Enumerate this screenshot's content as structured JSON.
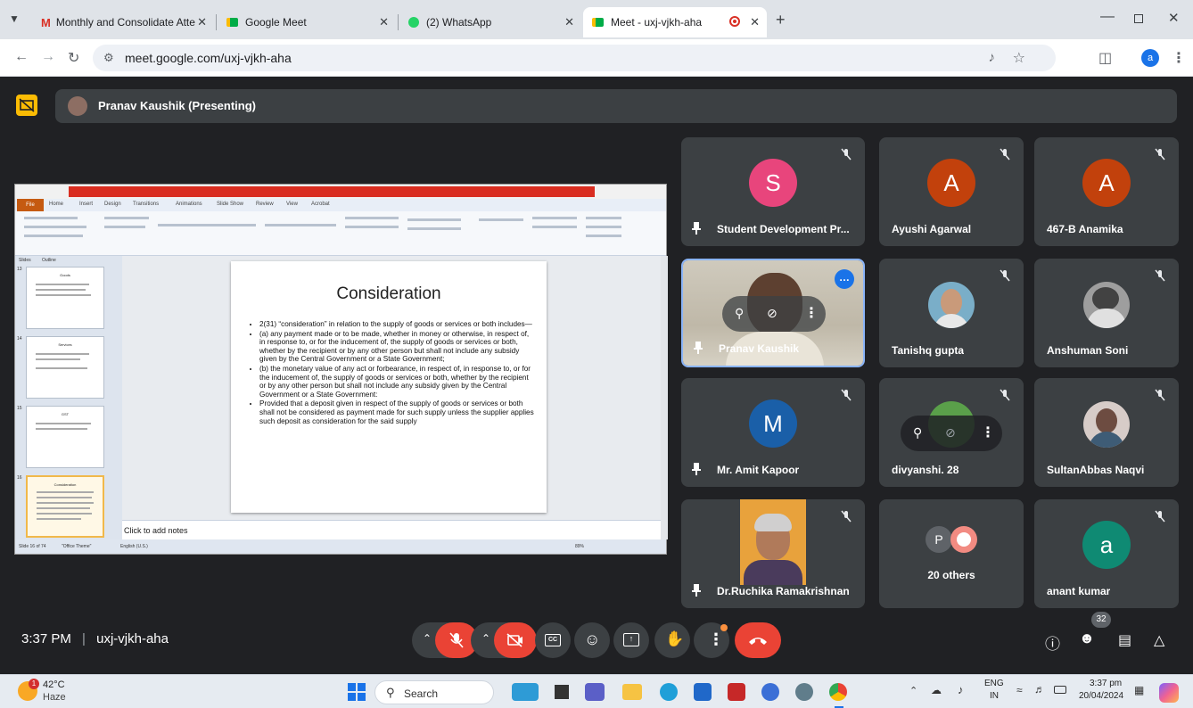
{
  "browser": {
    "tabs": [
      {
        "title": "Monthly and Consolidate Atte",
        "icon": "gmail-icon"
      },
      {
        "title": "Google Meet",
        "icon": "meet-icon"
      },
      {
        "title": "(2) WhatsApp",
        "icon": "whatsapp-icon"
      },
      {
        "title": "Meet - uxj-vjkh-aha",
        "icon": "meet-icon",
        "active": true
      }
    ],
    "url": "meet.google.com/uxj-vjkh-aha"
  },
  "meet": {
    "presenter_banner": "Pranav Kaushik (Presenting)",
    "share": {
      "slide_title": "Consideration",
      "bullets": [
        "2(31) “consideration” in relation to the supply of goods or services or both includes—",
        "(a) any payment made or to be made, whether in money or otherwise, in respect of, in response to, or for the inducement of, the supply of goods or services or both, whether by the recipient or by any other person but shall not include any subsidy given by the Central Government or a State Government;",
        "(b) the monetary value of any act or forbearance, in respect of, in response to, or for the inducement of, the supply of goods or services or both, whether by the recipient or by any other person but shall not include any subsidy given by the Central Government or a State Government:",
        "Provided that a deposit given in respect of the supply of goods or services or both shall not be considered as payment made for such supply unless the supplier applies such deposit as consideration for the said supply"
      ],
      "notes_placeholder": "Click to add notes",
      "thumb_titles": [
        "Goods",
        "Services",
        "GST",
        "Consideration"
      ],
      "thumb_numbers": [
        "13",
        "14",
        "15",
        "16"
      ],
      "ribbon_tabs": [
        "Home",
        "Insert",
        "Design",
        "Transitions",
        "Animations",
        "Slide Show",
        "Review",
        "View",
        "Acrobat"
      ],
      "file_tab": "File",
      "panel_tabs": [
        "Slides",
        "Outline"
      ],
      "status": [
        "Slide 16 of 74",
        "\"Office Theme\"",
        "English (U.S.)",
        "89%"
      ]
    },
    "participants": [
      {
        "name": "Student Development Pr...",
        "initial": "S",
        "color": "#e8457c",
        "pinned": true
      },
      {
        "name": "Ayushi Agarwal",
        "initial": "A",
        "color": "#c2410c"
      },
      {
        "name": "467-B Anamika",
        "initial": "A",
        "color": "#c2410c"
      },
      {
        "name": "Pranav Kaushik",
        "pinned": true,
        "speaking": true
      },
      {
        "name": "Tanishq gupta"
      },
      {
        "name": "Anshuman Soni"
      },
      {
        "name": "Mr. Amit Kapoor",
        "initial": "M",
        "color": "#1a5fa8",
        "pinned": true
      },
      {
        "name": "divyanshi. 28"
      },
      {
        "name": "SultanAbbas Naqvi"
      },
      {
        "name": "Dr.Ruchika Ramakrishnan",
        "pinned": true
      },
      {
        "name": "20 others",
        "initial": "P"
      },
      {
        "name": "anant kumar",
        "initial": "a",
        "color": "#0f8a73"
      }
    ],
    "meeting_time": "3:37 PM",
    "meeting_code": "uxj-vjkh-aha",
    "people_count": "32"
  },
  "taskbar": {
    "weather_temp": "42°C",
    "weather_desc": "Haze",
    "weather_badge": "1",
    "search": "Search",
    "lang_top": "ENG",
    "lang_bottom": "IN",
    "time": "3:37 pm",
    "date": "20/04/2024"
  }
}
